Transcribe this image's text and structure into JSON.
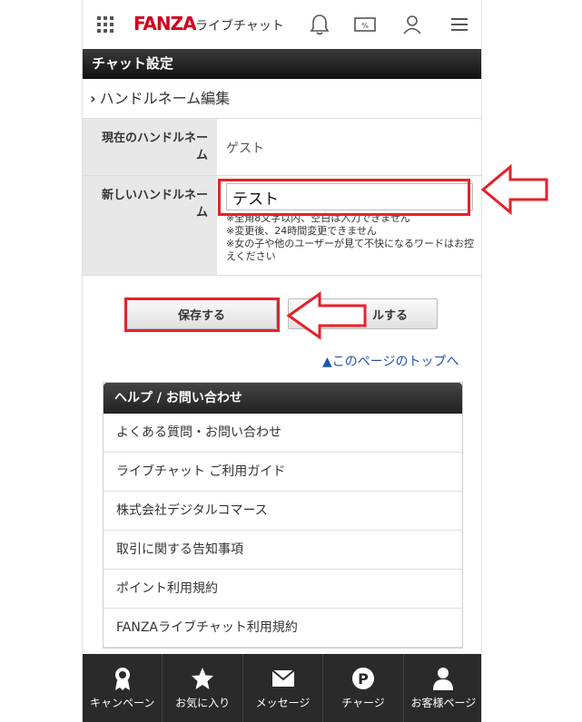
{
  "header": {
    "logo": "FANZA",
    "logo_sub": "ライブチャット",
    "icons": [
      "grid-menu-icon",
      "bell-icon",
      "coupon-icon",
      "user-icon",
      "hamburger-icon"
    ],
    "brand_color": "#d2001e"
  },
  "titlebar": {
    "title": "チャット設定"
  },
  "section": {
    "title": "ハンドルネーム編集",
    "chevron": "›"
  },
  "form": {
    "current_label": "現在のハンドルネーム",
    "current_value": "ゲスト",
    "new_label": "新しいハンドルネーム",
    "new_value": "テスト",
    "notes": [
      "※全角8文字以内、空白は入力できません",
      "※変更後、24時間変更できません",
      "※女の子や他のユーザーが見て不快になるワードはお控えください"
    ]
  },
  "buttons": {
    "save": "保存する",
    "cancel": "ルする"
  },
  "toplink": "▲このページのトップへ",
  "help": {
    "header": "ヘルプ / お問い合わせ",
    "items": [
      "よくある質問・お問い合わせ",
      "ライブチャット ご利用ガイド",
      "株式会社デジタルコマース",
      "取引に関する告知事項",
      "ポイント利用規約",
      "FANZAライブチャット利用規約"
    ]
  },
  "bottomnav": [
    {
      "label": "キャンペーン",
      "icon": "campaign-icon"
    },
    {
      "label": "お気に入り",
      "icon": "star-icon"
    },
    {
      "label": "メッセージ",
      "icon": "mail-icon"
    },
    {
      "label": "チャージ",
      "icon": "charge-icon"
    },
    {
      "label": "お客様ページ",
      "icon": "account-icon"
    }
  ],
  "annotation_color": "#e8202a"
}
